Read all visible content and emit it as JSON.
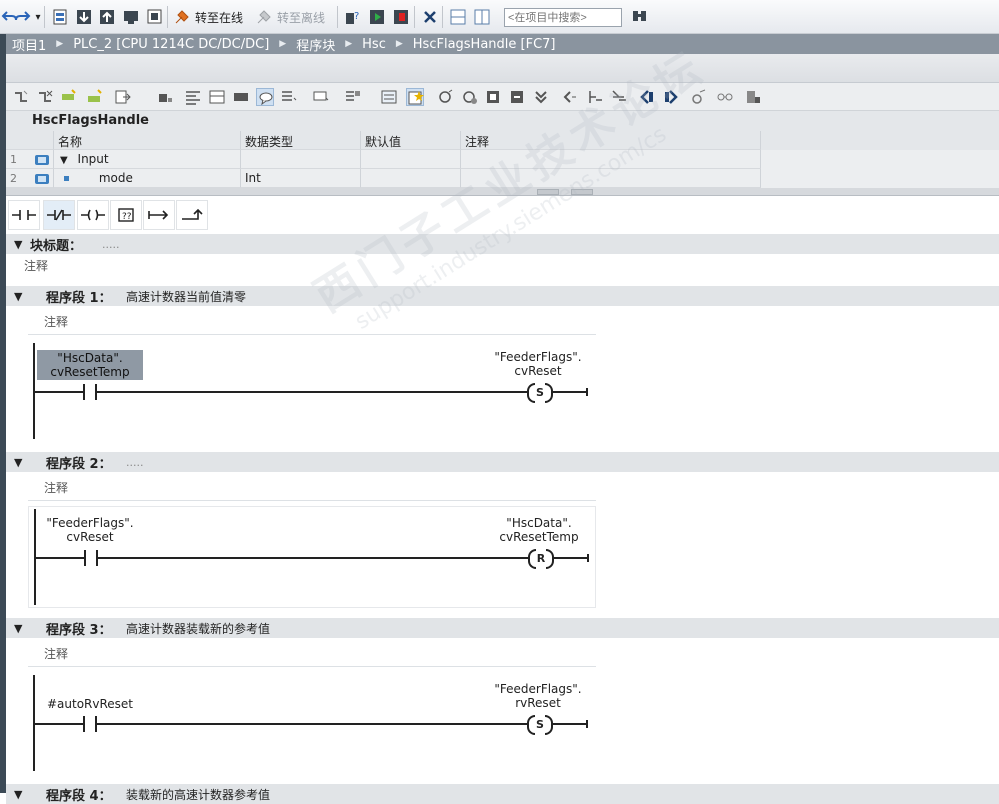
{
  "toolbar": {
    "go_online_label": "转至在线",
    "go_offline_label": "转至离线",
    "search_placeholder": "<在项目中搜索>"
  },
  "breadcrumb": [
    "项目1",
    "PLC_2 [CPU 1214C DC/DC/DC]",
    "程序块",
    "Hsc",
    "HscFlagsHandle [FC7]"
  ],
  "interface": {
    "block_name": "HscFlagsHandle",
    "columns": [
      "名称",
      "数据类型",
      "默认值",
      "注释"
    ],
    "rows": [
      {
        "num": "1",
        "name": "Input",
        "type": "",
        "default": "",
        "comment": ""
      },
      {
        "num": "2",
        "name": "mode",
        "type": "Int",
        "default": "",
        "comment": ""
      }
    ]
  },
  "block_title": {
    "label": "块标题：",
    "dots": ".....",
    "comment": "注释"
  },
  "networks": [
    {
      "title": "程序段 1：",
      "description": "高速计数器当前值清零",
      "comment": "注释",
      "contact_line1": "\"HscData\".",
      "contact_line2": "cvResetTemp",
      "coil_line1": "\"FeederFlags\".",
      "coil_line2": "cvReset",
      "coil_type": "S"
    },
    {
      "title": "程序段 2：",
      "description": ".....",
      "comment": "注释",
      "contact_line1": "\"FeederFlags\".",
      "contact_line2": "cvReset",
      "coil_line1": "\"HscData\".",
      "coil_line2": "cvResetTemp",
      "coil_type": "R"
    },
    {
      "title": "程序段 3：",
      "description": "高速计数器装载新的参考值",
      "comment": "注释",
      "contact_line1": "#autoRvReset",
      "coil_line1": "\"FeederFlags\".",
      "coil_line2": "rvReset",
      "coil_type": "S"
    },
    {
      "title": "程序段 4：",
      "description": "装载新的高速计数器参考值"
    }
  ],
  "watermark": {
    "line1": "西门子工业技术论坛",
    "line2": "support.industry.siemens.com/cs"
  },
  "icons": [
    "redo-icon",
    "save-project-icon",
    "download-icon",
    "upload-icon",
    "go-online-icon",
    "go-offline-icon",
    "accessible-devices-icon",
    "start-cpu-icon",
    "stop-cpu-icon",
    "cross-reference-icon",
    "split-horizontal-icon",
    "split-vertical-icon",
    "search-project-icon"
  ],
  "colors": {
    "breadcrumb_bg": "#8a949f",
    "section_header_bg": "#e1e4e7",
    "highlight_operand": "#8f99a4"
  }
}
